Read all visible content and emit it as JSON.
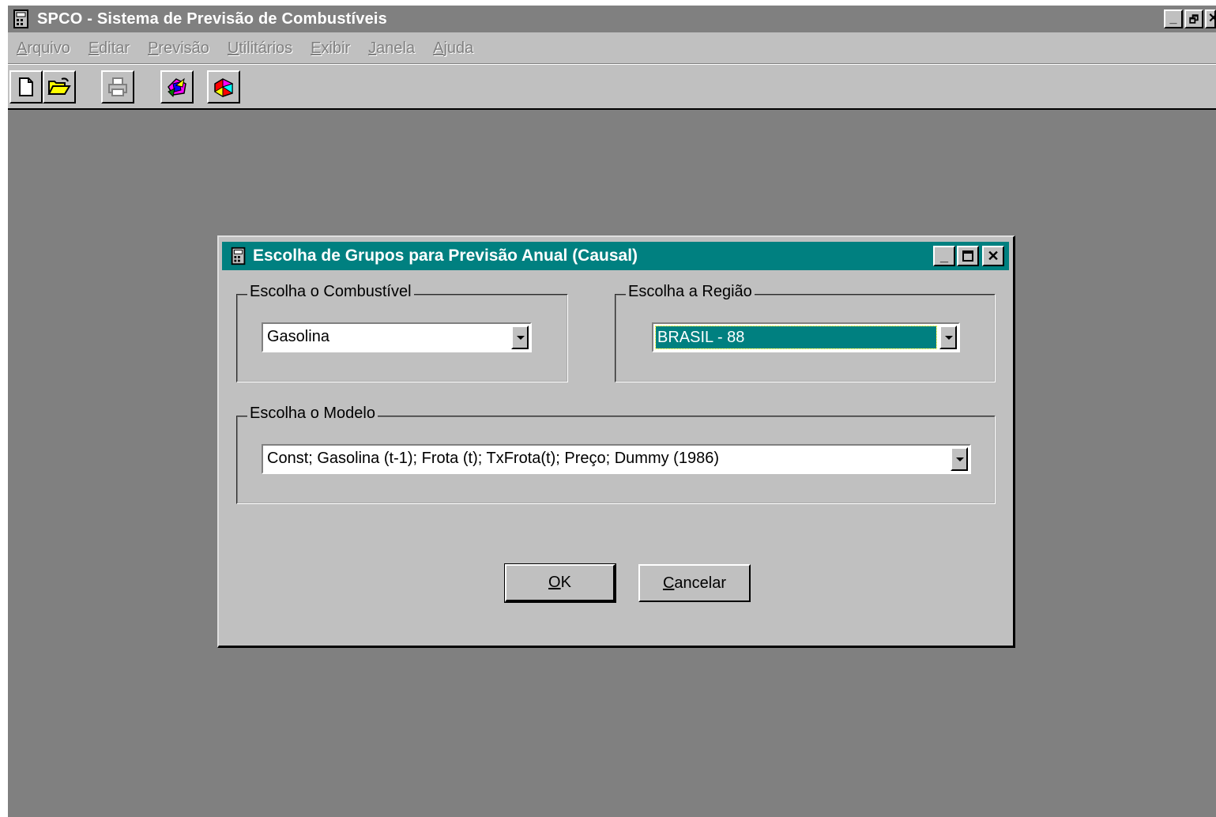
{
  "window": {
    "title": "SPCO - Sistema de Previsão de Combustíveis",
    "buttons": {
      "minimize": "_",
      "restore": "🗗",
      "close": "✕"
    }
  },
  "menubar": {
    "items": [
      {
        "label": "Arquivo",
        "mnemonic": "A",
        "rest": "rquivo"
      },
      {
        "label": "Editar",
        "mnemonic": "E",
        "rest": "ditar"
      },
      {
        "label": "Previsão",
        "mnemonic": "P",
        "rest": "revisão"
      },
      {
        "label": "Utilitários",
        "mnemonic": "U",
        "rest": "tilitários"
      },
      {
        "label": "Exibir",
        "mnemonic": "E",
        "rest": "xibir"
      },
      {
        "label": "Janela",
        "mnemonic": "J",
        "rest": "anela"
      },
      {
        "label": "Ajuda",
        "mnemonic": "A",
        "rest": "juda"
      }
    ]
  },
  "toolbar": {
    "icons": [
      "new-document-icon",
      "open-folder-icon",
      "print-icon",
      "forecast-icon",
      "chart-icon"
    ]
  },
  "dialog": {
    "title": "Escolha de Grupos para Previsão Anual (Causal)",
    "fuel_group": {
      "label": "Escolha o Combustível",
      "value": "Gasolina"
    },
    "region_group": {
      "label": "Escolha a Região",
      "value": "BRASIL - 88"
    },
    "model_group": {
      "label": "Escolha o Modelo",
      "value": "Const; Gasolina (t-1); Frota (t); TxFrota(t); Preço; Dummy (1986)"
    },
    "ok_button": {
      "mnemonic": "O",
      "rest": "K"
    },
    "cancel_button": {
      "mnemonic": "C",
      "rest": "ancelar"
    }
  },
  "colors": {
    "desktop": "#808080",
    "face": "#c0c0c0",
    "active_title": "#008080",
    "inactive_title": "#808080",
    "selection": "#008080"
  }
}
